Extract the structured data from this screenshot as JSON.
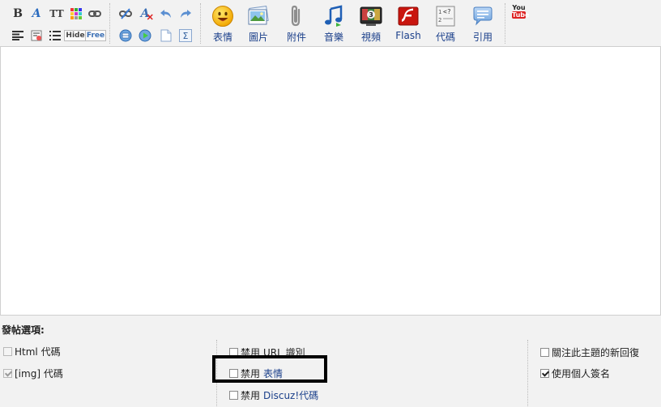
{
  "toolbar": {
    "row1_small": [
      {
        "name": "bold-button",
        "icon": "bold-icon",
        "glyph": "B"
      },
      {
        "name": "font-button",
        "icon": "font-icon",
        "glyph": "A"
      },
      {
        "name": "font-size-button",
        "icon": "font-size-icon",
        "glyph": "TT"
      },
      {
        "name": "color-button",
        "icon": "color-palette-icon",
        "glyph": ""
      },
      {
        "name": "link-button",
        "icon": "link-icon",
        "glyph": ""
      },
      {
        "name": "unlink-button",
        "icon": "unlink-icon",
        "glyph": ""
      },
      {
        "name": "remove-format-button",
        "icon": "remove-format-icon",
        "glyph": "A"
      },
      {
        "name": "undo-button",
        "icon": "undo-icon",
        "glyph": ""
      },
      {
        "name": "redo-button",
        "icon": "redo-icon",
        "glyph": ""
      }
    ],
    "row2_small": [
      {
        "name": "align-button",
        "icon": "align-left-icon",
        "glyph": ""
      },
      {
        "name": "float-button",
        "icon": "float-icon",
        "glyph": ""
      },
      {
        "name": "list-button",
        "icon": "list-icon",
        "glyph": ""
      },
      {
        "name": "hide-button",
        "icon": "hide-icon",
        "glyph": "Hide"
      },
      {
        "name": "free-button",
        "icon": "free-icon",
        "glyph": "Free"
      },
      {
        "name": "table-button",
        "icon": "table-icon",
        "glyph": ""
      },
      {
        "name": "media-button",
        "icon": "media-icon",
        "glyph": ""
      },
      {
        "name": "page-button",
        "icon": "page-icon",
        "glyph": ""
      },
      {
        "name": "sum-button",
        "icon": "sum-icon",
        "glyph": "Σ"
      }
    ],
    "big": [
      {
        "name": "smiley-button",
        "icon": "smiley-icon",
        "label": "表情"
      },
      {
        "name": "image-button",
        "icon": "picture-icon",
        "label": "圖片"
      },
      {
        "name": "attach-button",
        "icon": "paperclip-icon",
        "label": "附件"
      },
      {
        "name": "audio-button",
        "icon": "music-note-icon",
        "label": "音樂"
      },
      {
        "name": "video-button",
        "icon": "video-icon",
        "label": "視頻"
      },
      {
        "name": "flash-button",
        "icon": "flash-icon",
        "label": "Flash"
      },
      {
        "name": "code-button",
        "icon": "code-icon",
        "label": "代碼"
      },
      {
        "name": "quote-button",
        "icon": "quote-bubble-icon",
        "label": "引用"
      }
    ],
    "youtube": {
      "line1": "You",
      "line2": "Tube"
    }
  },
  "options": {
    "title": "發帖選項:",
    "items": [
      {
        "name": "html-code-option",
        "label": "Html 代碼",
        "checked": false,
        "disabled": true
      },
      {
        "name": "img-code-option",
        "label": "[img] 代碼",
        "checked": true,
        "disabled": true
      },
      {
        "name": "disable-url-option",
        "prefix": "禁用",
        "label": "URL 識別",
        "checked": false,
        "disabled": false
      },
      {
        "name": "disable-smilies-option",
        "prefix": "禁用",
        "label": "表情",
        "checked": false,
        "disabled": false
      },
      {
        "name": "disable-discuz-option",
        "prefix": "禁用",
        "label": "Discuz!代碼",
        "checked": false,
        "disabled": false
      },
      {
        "name": "subscribe-option",
        "label": "關注此主題的新回復",
        "checked": false,
        "disabled": false
      },
      {
        "name": "signature-option",
        "label": "使用個人簽名",
        "checked": true,
        "disabled": false
      }
    ]
  }
}
